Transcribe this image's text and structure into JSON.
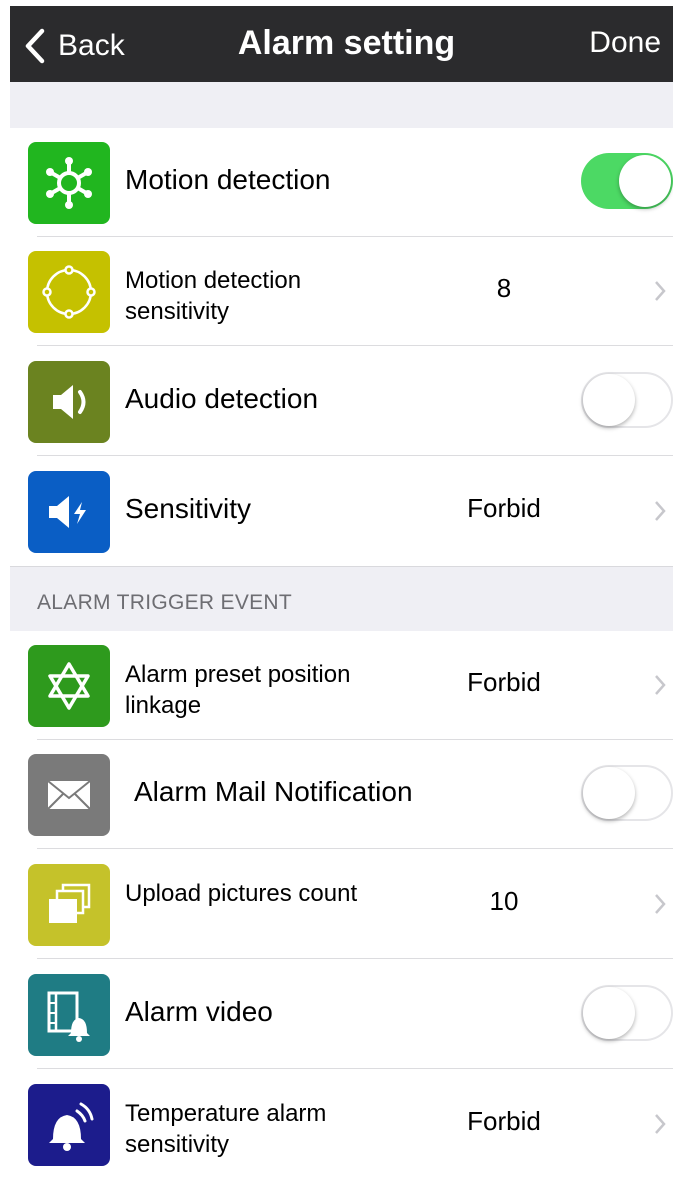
{
  "navbar": {
    "back_label": "Back",
    "title": "Alarm setting",
    "done_label": "Done"
  },
  "section1": {
    "rows": [
      {
        "label": "Motion detection",
        "control": "toggle",
        "on": true,
        "icon": "motion-detection-icon",
        "icon_color": "#21b61f"
      },
      {
        "label": "Motion detection sensitivity",
        "value": "8",
        "control": "chevron",
        "icon": "sensitivity-circle-icon",
        "icon_color": "#c5c100"
      },
      {
        "label": "Audio detection",
        "control": "toggle",
        "on": false,
        "icon": "speaker-icon",
        "icon_color": "#6b8320"
      },
      {
        "label": "Sensitivity",
        "value": "Forbid",
        "control": "chevron",
        "icon": "speaker-bolt-icon",
        "icon_color": "#0a5ec5"
      }
    ]
  },
  "section2": {
    "header": "ALARM TRIGGER EVENT",
    "rows": [
      {
        "label": "Alarm preset position linkage",
        "value": "Forbid",
        "control": "chevron",
        "icon": "star-of-david-icon",
        "icon_color": "#2e9a1d"
      },
      {
        "label": "Alarm Mail Notification",
        "control": "toggle",
        "on": false,
        "icon": "envelope-icon",
        "icon_color": "#7a7a7a"
      },
      {
        "label": "Upload pictures count",
        "value": "10",
        "control": "chevron",
        "icon": "stacked-pictures-icon",
        "icon_color": "#c5c22a"
      },
      {
        "label": "Alarm video",
        "control": "toggle",
        "on": false,
        "icon": "film-bell-icon",
        "icon_color": "#1f7c84"
      },
      {
        "label": "Temperature alarm sensitivity",
        "value": "Forbid",
        "control": "chevron",
        "icon": "bell-ring-icon",
        "icon_color": "#1c1c8c"
      }
    ]
  },
  "colors": {
    "navbar": "#2b2b2d",
    "toggle_on": "#4cd964",
    "group_bg": "#efeff4"
  }
}
